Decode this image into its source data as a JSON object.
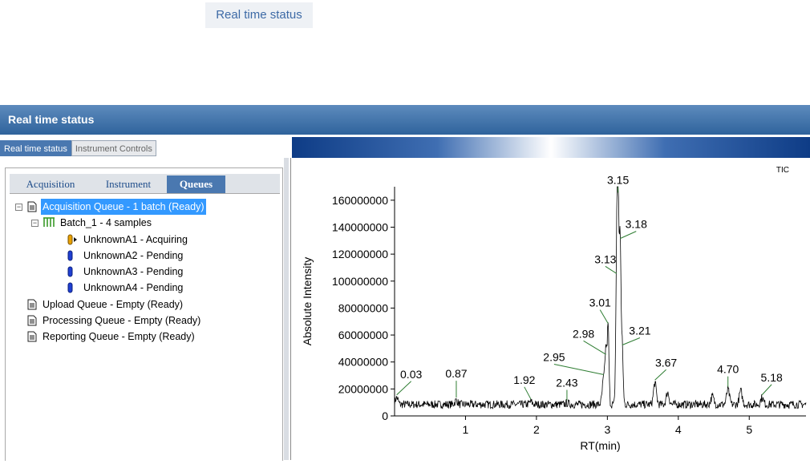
{
  "page_label": "Real time status",
  "window": {
    "title": "Real time status",
    "outer_tabs": [
      {
        "label": "Real time status",
        "active": true
      },
      {
        "label": "Instrument Controls",
        "active": false
      }
    ],
    "inner_tabs": [
      {
        "label": "Acquisition",
        "active": false
      },
      {
        "label": "Instrument",
        "active": false
      },
      {
        "label": "Queues",
        "active": true
      }
    ]
  },
  "tree": {
    "acquisition_queue": "Acquisition Queue - 1 batch (Ready)",
    "batch": "Batch_1 - 4 samples",
    "samples": [
      {
        "label": "UnknownA1 - Acquiring",
        "status": "acquiring"
      },
      {
        "label": "UnknownA2 - Pending",
        "status": "pending"
      },
      {
        "label": "UnknownA3 - Pending",
        "status": "pending"
      },
      {
        "label": "UnknownA4 - Pending",
        "status": "pending"
      }
    ],
    "upload_queue": "Upload Queue - Empty (Ready)",
    "processing_queue": "Processing Queue - Empty (Ready)",
    "reporting_queue": "Reporting Queue - Empty (Ready)"
  },
  "colors": {
    "titlebar": "#2f639c",
    "selection": "#3399ff",
    "tab_active": "#4a78b0",
    "tube_pending": "#1f3fd1",
    "tube_acquiring": "#e9a100",
    "batch_icon": "#3a9a2a",
    "peak_label_line": "#2e7d32"
  },
  "chart_data": {
    "type": "line",
    "corner_label": "TIC",
    "xlabel": "RT(min)",
    "ylabel": "Absolute Intensity",
    "xlim": [
      0,
      5.8
    ],
    "ylim": [
      0,
      170000000
    ],
    "x_ticks": [
      1,
      2,
      3,
      4,
      5
    ],
    "y_ticks": [
      0,
      20000000,
      40000000,
      60000000,
      80000000,
      100000000,
      120000000,
      140000000,
      160000000
    ],
    "y_tick_labels": [
      "0",
      "20000000",
      "40000000",
      "60000000",
      "80000000",
      "100000000",
      "120000000",
      "140000000",
      "160000000"
    ],
    "baseline": 10000000,
    "peaks": [
      {
        "rt": 0.03,
        "height": 15000000,
        "label": "0.03"
      },
      {
        "rt": 0.87,
        "height": 13000000,
        "label": "0.87"
      },
      {
        "rt": 1.92,
        "height": 12000000,
        "label": "1.92"
      },
      {
        "rt": 2.43,
        "height": 11000000,
        "label": "2.43"
      },
      {
        "rt": 2.95,
        "height": 30000000,
        "label": "2.95"
      },
      {
        "rt": 2.98,
        "height": 45000000,
        "label": "2.98"
      },
      {
        "rt": 3.01,
        "height": 68000000,
        "label": "3.01"
      },
      {
        "rt": 3.13,
        "height": 105000000,
        "label": "3.13"
      },
      {
        "rt": 3.15,
        "height": 165000000,
        "label": "3.15"
      },
      {
        "rt": 3.18,
        "height": 131000000,
        "label": "3.18"
      },
      {
        "rt": 3.21,
        "height": 52000000,
        "label": "3.21"
      },
      {
        "rt": 3.67,
        "height": 26000000,
        "label": "3.67"
      },
      {
        "rt": 3.85,
        "height": 19000000,
        "label": ""
      },
      {
        "rt": 4.48,
        "height": 16000000,
        "label": ""
      },
      {
        "rt": 4.7,
        "height": 21000000,
        "label": "4.70"
      },
      {
        "rt": 4.88,
        "height": 20000000,
        "label": ""
      },
      {
        "rt": 5.18,
        "height": 15000000,
        "label": "5.18"
      }
    ]
  }
}
